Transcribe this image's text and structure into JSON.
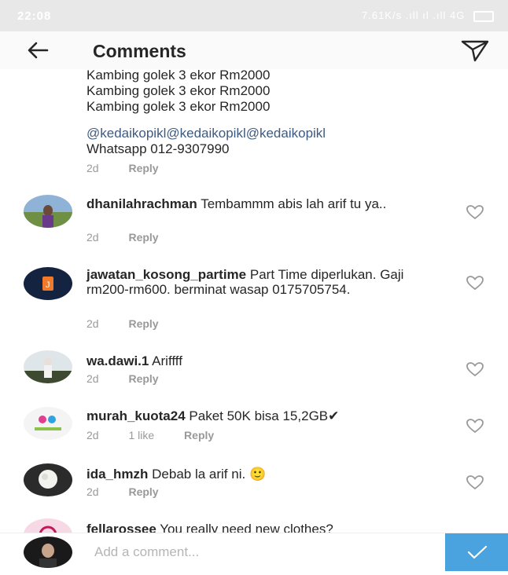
{
  "status_bar": {
    "time": "22:08",
    "right_text": "7.61K/s  .ıll ıl  .ıll 4G"
  },
  "header": {
    "title": "Comments",
    "back_icon": "arrow-left-icon",
    "send_icon": "paper-plane-icon"
  },
  "caption": {
    "lines": [
      "Kambing golek 3 ekor Rm2000",
      "Kambing golek 3 ekor Rm2000",
      "Kambing golek 3 ekor Rm2000"
    ],
    "mentions": "@kedaikopikl@kedaikopikl@kedaikopikl",
    "contact": "Whatsapp 012-9307990",
    "time": "2d",
    "reply_label": "Reply"
  },
  "comments": [
    {
      "username": "dhanilahrachman",
      "text": "Tembammm abis lah arif tu ya..",
      "time": "2d",
      "likes": "",
      "reply_label": "Reply"
    },
    {
      "username": "jawatan_kosong_partime",
      "text": "Part Time diperlukan. Gaji rm200-rm600. berminat wasap 0175705754.",
      "time": "2d",
      "likes": "",
      "reply_label": "Reply"
    },
    {
      "username": "wa.dawi.1",
      "text": "Ariffff",
      "time": "2d",
      "likes": "",
      "reply_label": "Reply"
    },
    {
      "username": "murah_kuota24",
      "text": "Paket 50K bisa 15,2GB✔",
      "time": "2d",
      "likes": "1 like",
      "reply_label": "Reply"
    },
    {
      "username": "ida_hmzh",
      "text": "Debab la arif ni.",
      "emoji": "🙂",
      "time": "2d",
      "likes": "",
      "reply_label": "Reply"
    },
    {
      "username": "fellarossee",
      "text": "You really need new clothes?",
      "time": "",
      "likes": "",
      "reply_label": ""
    }
  ],
  "composer": {
    "placeholder": "Add a comment..."
  },
  "colors": {
    "link": "#3d5a80",
    "meta": "#999999",
    "post_button": "#4aa3df",
    "status_bar": "#e8e8e8"
  }
}
